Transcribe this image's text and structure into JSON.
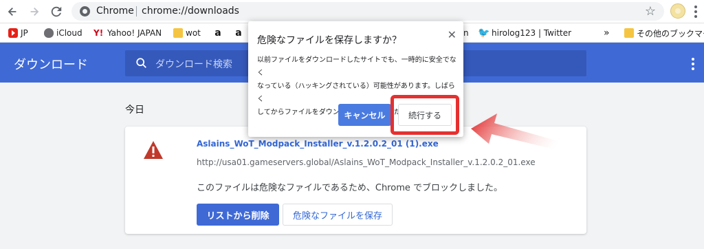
{
  "browser": {
    "site_label": "Chrome",
    "url": "chrome://downloads"
  },
  "bookmarks": [
    {
      "label": "JP",
      "icon": "youtube-icon"
    },
    {
      "label": "iCloud",
      "icon": "apple-icon"
    },
    {
      "label": "Yahoo! JAPAN",
      "icon": "yahoo-icon"
    },
    {
      "label": "wot",
      "icon": "folder-icon"
    },
    {
      "label": "",
      "icon": "amazon-icon"
    },
    {
      "label": "",
      "icon": "amazon-icon"
    },
    {
      "label": "n",
      "icon": ""
    },
    {
      "label": "hirolog123 | Twitter",
      "icon": "twitter-icon"
    },
    {
      "label": "»",
      "icon": "chevron-icon"
    },
    {
      "label": "その他のブックマーク",
      "icon": "folder-icon"
    }
  ],
  "header": {
    "title": "ダウンロード",
    "search_placeholder": "ダウンロード検索"
  },
  "content": {
    "date_label": "今日",
    "file_name": "Aslains_WoT_Modpack_Installer_v.1.2.0.2_01 (1).exe",
    "file_url": "http://usa01.gameservers.global/Aslains_WoT_Modpack_Installer_v.1.2.0.2_01.exe",
    "status": "このファイルは危険なファイルであるため、Chrome でブロックしました。",
    "remove_label": "リストから削除",
    "save_danger_label": "危険なファイルを保存"
  },
  "dialog": {
    "title": "危険なファイルを保存しますか？",
    "body_lines": [
      "以前ファイルをダウンロードしたサイトでも、一時的に安全でなく",
      "なっている（ハッキングされている）可能性があります。しばらく",
      "してからファイルをダウンロードしてみてください。"
    ],
    "cancel_label": "キャンセル",
    "continue_label": "続行する"
  },
  "colors": {
    "header_blue": "#3f6ad6",
    "link_blue": "#3367d6",
    "warning_red": "#c0392b",
    "highlight_red": "#e53030"
  }
}
